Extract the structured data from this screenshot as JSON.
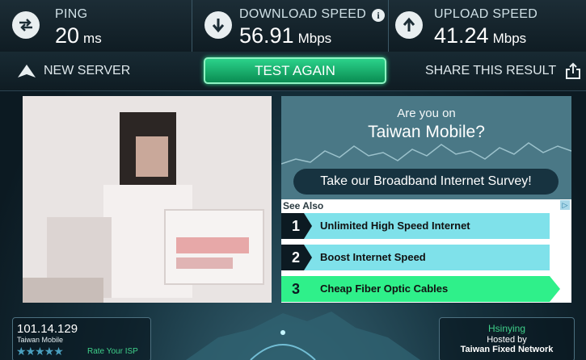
{
  "metrics": {
    "ping": {
      "label": "PING",
      "value": "20",
      "unit": "ms"
    },
    "download": {
      "label": "DOWNLOAD SPEED",
      "value": "56.91",
      "unit": "Mbps"
    },
    "upload": {
      "label": "UPLOAD SPEED",
      "value": "41.24",
      "unit": "Mbps"
    }
  },
  "actions": {
    "new_server": "NEW SERVER",
    "test_again": "TEST AGAIN",
    "share": "SHARE THIS RESULT"
  },
  "survey": {
    "line1": "Are you on",
    "line2": "Taiwan Mobile?",
    "cta": "Take our Broadband Internet Survey!"
  },
  "see_also": {
    "header": "See Also",
    "items": [
      {
        "num": "1",
        "label": "Unlimited High Speed Internet"
      },
      {
        "num": "2",
        "label": "Boost Internet Speed"
      },
      {
        "num": "3",
        "label": "Cheap Fiber Optic Cables"
      }
    ]
  },
  "client": {
    "ip": "101.14.129",
    "isp": "Taiwan Mobile",
    "stars": "★★★★★",
    "rate": "Rate Your ISP"
  },
  "server": {
    "city": "Hsinying",
    "hosted_by": "Hosted by",
    "network": "Taiwan Fixed Network"
  },
  "colors": {
    "accent_green": "#2bd28a",
    "panel_teal": "#4a7886",
    "link_cyan": "#7fe1ea"
  }
}
